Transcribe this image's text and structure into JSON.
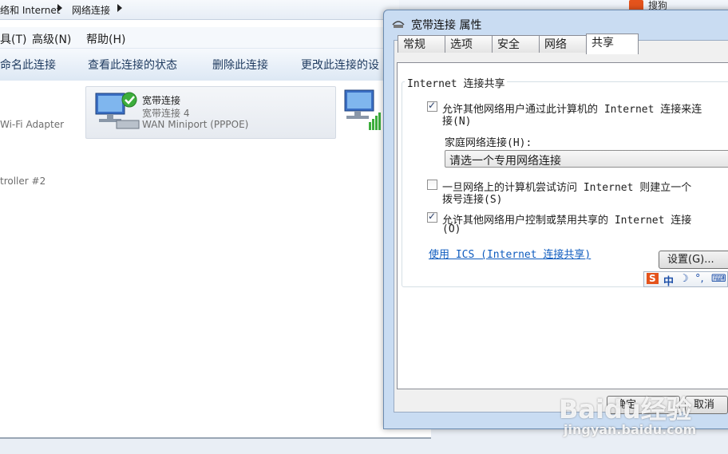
{
  "explorer": {
    "breadcrumb": [
      "络和 Internet",
      "网络连接"
    ],
    "menu": [
      "具(T)",
      "高级(N)",
      "帮助(H)"
    ],
    "commands": [
      "命名此连接",
      "查看此连接的状态",
      "删除此连接",
      "更改此连接的设"
    ],
    "adapters": {
      "left_adapter_text": "Wi-Fi Adapter",
      "left_controller_text": "troller #2",
      "tile": {
        "name": "宽带连接",
        "sub1": "宽带连接 4",
        "sub2": "WAN Miniport (PPPOE)"
      }
    }
  },
  "dialog": {
    "title": "宽带连接 属性",
    "tabs": [
      "常规",
      "选项",
      "安全",
      "网络",
      "共享"
    ],
    "active_tab": "共享",
    "group_title": "Internet 连接共享",
    "opt_allow_line1": "允许其他网络用户通过此计算机的 Internet 连接来连",
    "opt_allow_line2": "接(N)",
    "home_network_label": "家庭网络连接(H):",
    "home_network_select": "请选一个专用网络连接",
    "opt_dial_line1": "一旦网络上的计算机尝试访问 Internet 则建立一个",
    "opt_dial_line2": "拨号连接(S)",
    "opt_control_line1": "允许其他网络用户控制或禁用共享的 Internet 连接",
    "opt_control_line2": "(O)",
    "checked": {
      "allow": true,
      "dial": false,
      "control": true
    },
    "ics_link": "使用 ICS (Internet 连接共享)",
    "settings_button": "设置(G)...",
    "ok_button": "确定",
    "cancel_button": "取消"
  },
  "ime_toolbar": {
    "logo": "S",
    "mode": "中",
    "moon": "☽",
    "punct": "°,",
    "keyboard": "⌨"
  },
  "search_tab": "搜狗",
  "watermark": {
    "brand": "Baidu经验",
    "url": "jingyan.baidu.com"
  }
}
